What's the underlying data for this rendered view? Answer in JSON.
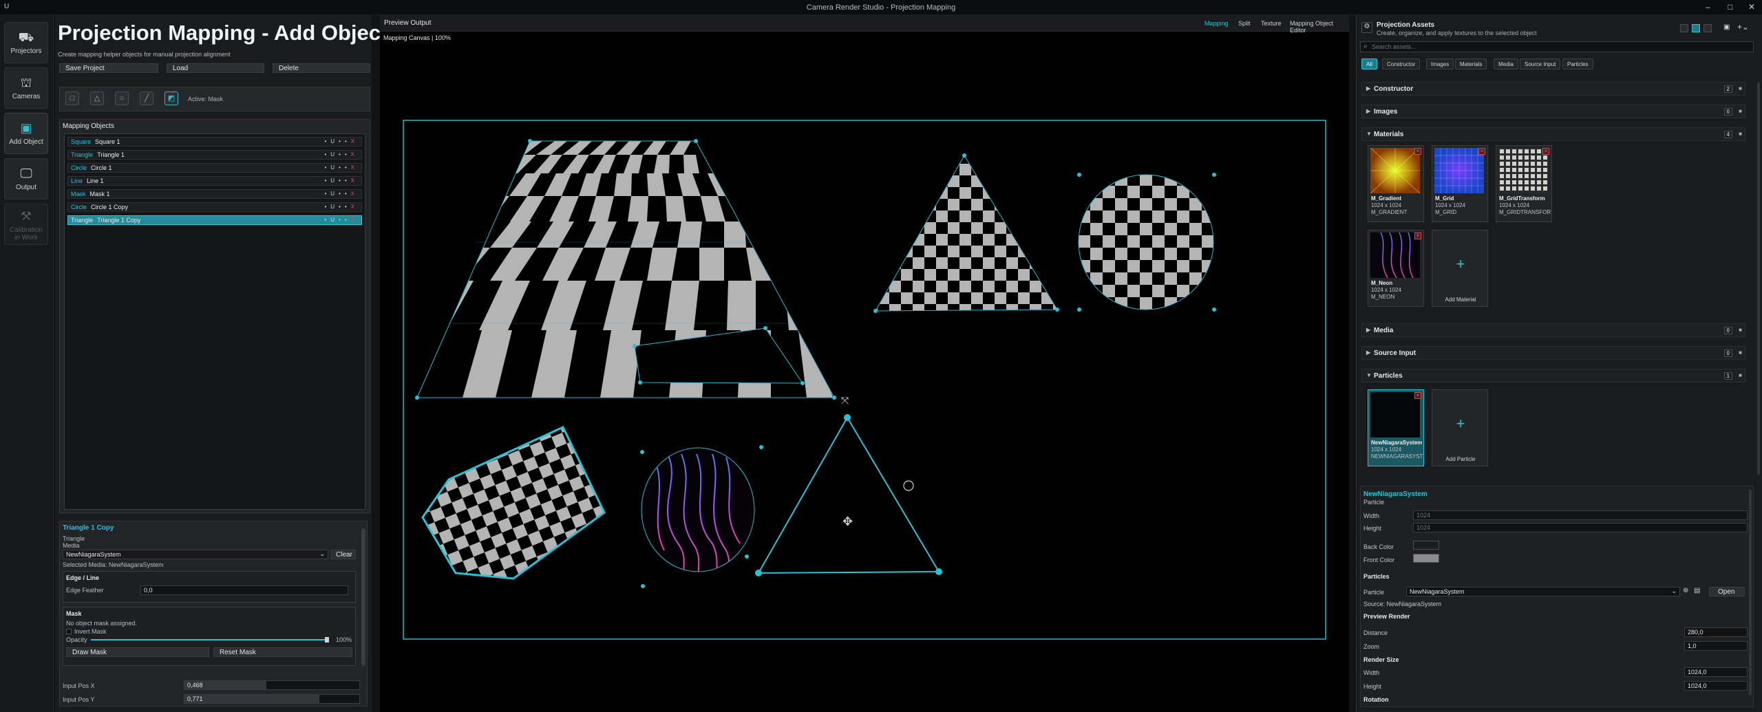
{
  "window": {
    "title": "Camera Render Studio - Projection Mapping"
  },
  "nav": {
    "items": [
      {
        "label": "Projectors",
        "icon": "projector-icon"
      },
      {
        "label": "Cameras",
        "icon": "camera-icon"
      },
      {
        "label": "Add Object",
        "icon": "add-object-icon"
      },
      {
        "label": "Output",
        "icon": "monitor-icon"
      },
      {
        "label": "Calibration",
        "label2": "in Work",
        "icon": "calibration-icon"
      }
    ]
  },
  "left": {
    "title": "Projection Mapping - Add Object",
    "subtitle": "Create mapping helper objects for manual projection alignment",
    "buttons": {
      "save": "Save Project",
      "load": "Load",
      "delete": "Delete"
    },
    "active_tool": "Active: Mask",
    "list_title": "Mapping Objects",
    "objects": [
      {
        "type": "Square",
        "name": "Square 1"
      },
      {
        "type": "Triangle",
        "name": "Triangle 1"
      },
      {
        "type": "Circle",
        "name": "Circle 1"
      },
      {
        "type": "Line",
        "name": "Line 1"
      },
      {
        "type": "Mask",
        "name": "Mask 1"
      },
      {
        "type": "Circle",
        "name": "Circle 1 Copy"
      },
      {
        "type": "Triangle",
        "name": "Triangle 1 Copy",
        "selected": true
      }
    ],
    "row_controls": {
      "a": "•",
      "b": "U",
      "c": "•",
      "d": "•",
      "x": "X"
    },
    "props": {
      "title": "Triangle 1 Copy",
      "kind": "Triangle",
      "media_label": "Media",
      "media_value": "NewNiagaraSystem",
      "clear": "Clear",
      "selected_media": "Selected Media: NewNiagaraSystem",
      "edge_title": "Edge / Line",
      "edge_feather_label": "Edge Feather",
      "edge_feather_value": "0,0",
      "mask_title": "Mask",
      "no_mask": "No object mask assigned.",
      "invert_mask": "Invert Mask",
      "opacity_label": "Opacity",
      "opacity_value": "100%",
      "draw_mask": "Draw Mask",
      "reset_mask": "Reset Mask",
      "input_pos_x_label": "Input Pos X",
      "input_pos_x_value": "0,468",
      "input_pos_y_label": "Input Pos Y",
      "input_pos_y_value": "0,771"
    }
  },
  "preview": {
    "title": "Preview Output",
    "tabs": [
      "Mapping",
      "Split",
      "Texture",
      "Mapping Object Editor"
    ],
    "active_tab": "Mapping",
    "canvas_label": "Mapping Canvas | 100%"
  },
  "assets": {
    "title": "Projection Assets",
    "subtitle": "Create, organize, and apply textures to the selected object",
    "search_placeholder": "Search assets...",
    "filters": [
      "All",
      "Constructor",
      "Images",
      "Materials",
      "Media",
      "Source Input",
      "Particles"
    ],
    "categories": [
      {
        "name": "Constructor",
        "count": "2",
        "open": false
      },
      {
        "name": "Images",
        "count": "0",
        "open": false
      },
      {
        "name": "Materials",
        "count": "4",
        "open": true
      },
      {
        "name": "Media",
        "count": "0",
        "open": false
      },
      {
        "name": "Source Input",
        "count": "0",
        "open": false
      },
      {
        "name": "Particles",
        "count": "1",
        "open": true
      }
    ],
    "materials": [
      {
        "name": "M_Gradient",
        "size": "1024 x 1024",
        "id": "M_GRADIENT"
      },
      {
        "name": "M_Grid",
        "size": "1024 x 1024",
        "id": "M_GRID"
      },
      {
        "name": "M_GridTransform",
        "size": "1024 x 1024",
        "id": "M_GRIDTRANSFOR"
      },
      {
        "name": "M_Neon",
        "size": "1024 x 1024",
        "id": "M_NEON"
      }
    ],
    "add_material": "Add Material",
    "particles": [
      {
        "name": "NewNiagaraSystem",
        "size": "1024 x 1024",
        "id": "NEWNIAGARASYST"
      }
    ],
    "add_particle": "Add Particle"
  },
  "detail": {
    "name": "NewNiagaraSystem",
    "kind": "Particle",
    "width_label": "Width",
    "width_value": "1024",
    "height_label": "Height",
    "height_value": "1024",
    "back_color_label": "Back Color",
    "back_color": "#1b1d1f",
    "front_color_label": "Front Color",
    "front_color": "#8c8c8c",
    "particles_title": "Particles",
    "particle_label": "Particle",
    "particle_value": "NewNiagaraSystem",
    "open": "Open",
    "source": "Source: NewNiagaraSystem",
    "preview_render": "Preview Render",
    "distance_label": "Distance",
    "distance_value": "280,0",
    "zoom_label": "Zoom",
    "zoom_value": "1,0",
    "render_size": "Render Size",
    "rs_width_label": "Width",
    "rs_width_value": "1024,0",
    "rs_height_label": "Height",
    "rs_height_value": "1024,0",
    "rotation": "Rotation"
  },
  "colors": {
    "accent": "#2bc0d2",
    "danger": "#e14b4b",
    "checker_light": "#b4b4b4",
    "checker_dark": "#000000"
  }
}
